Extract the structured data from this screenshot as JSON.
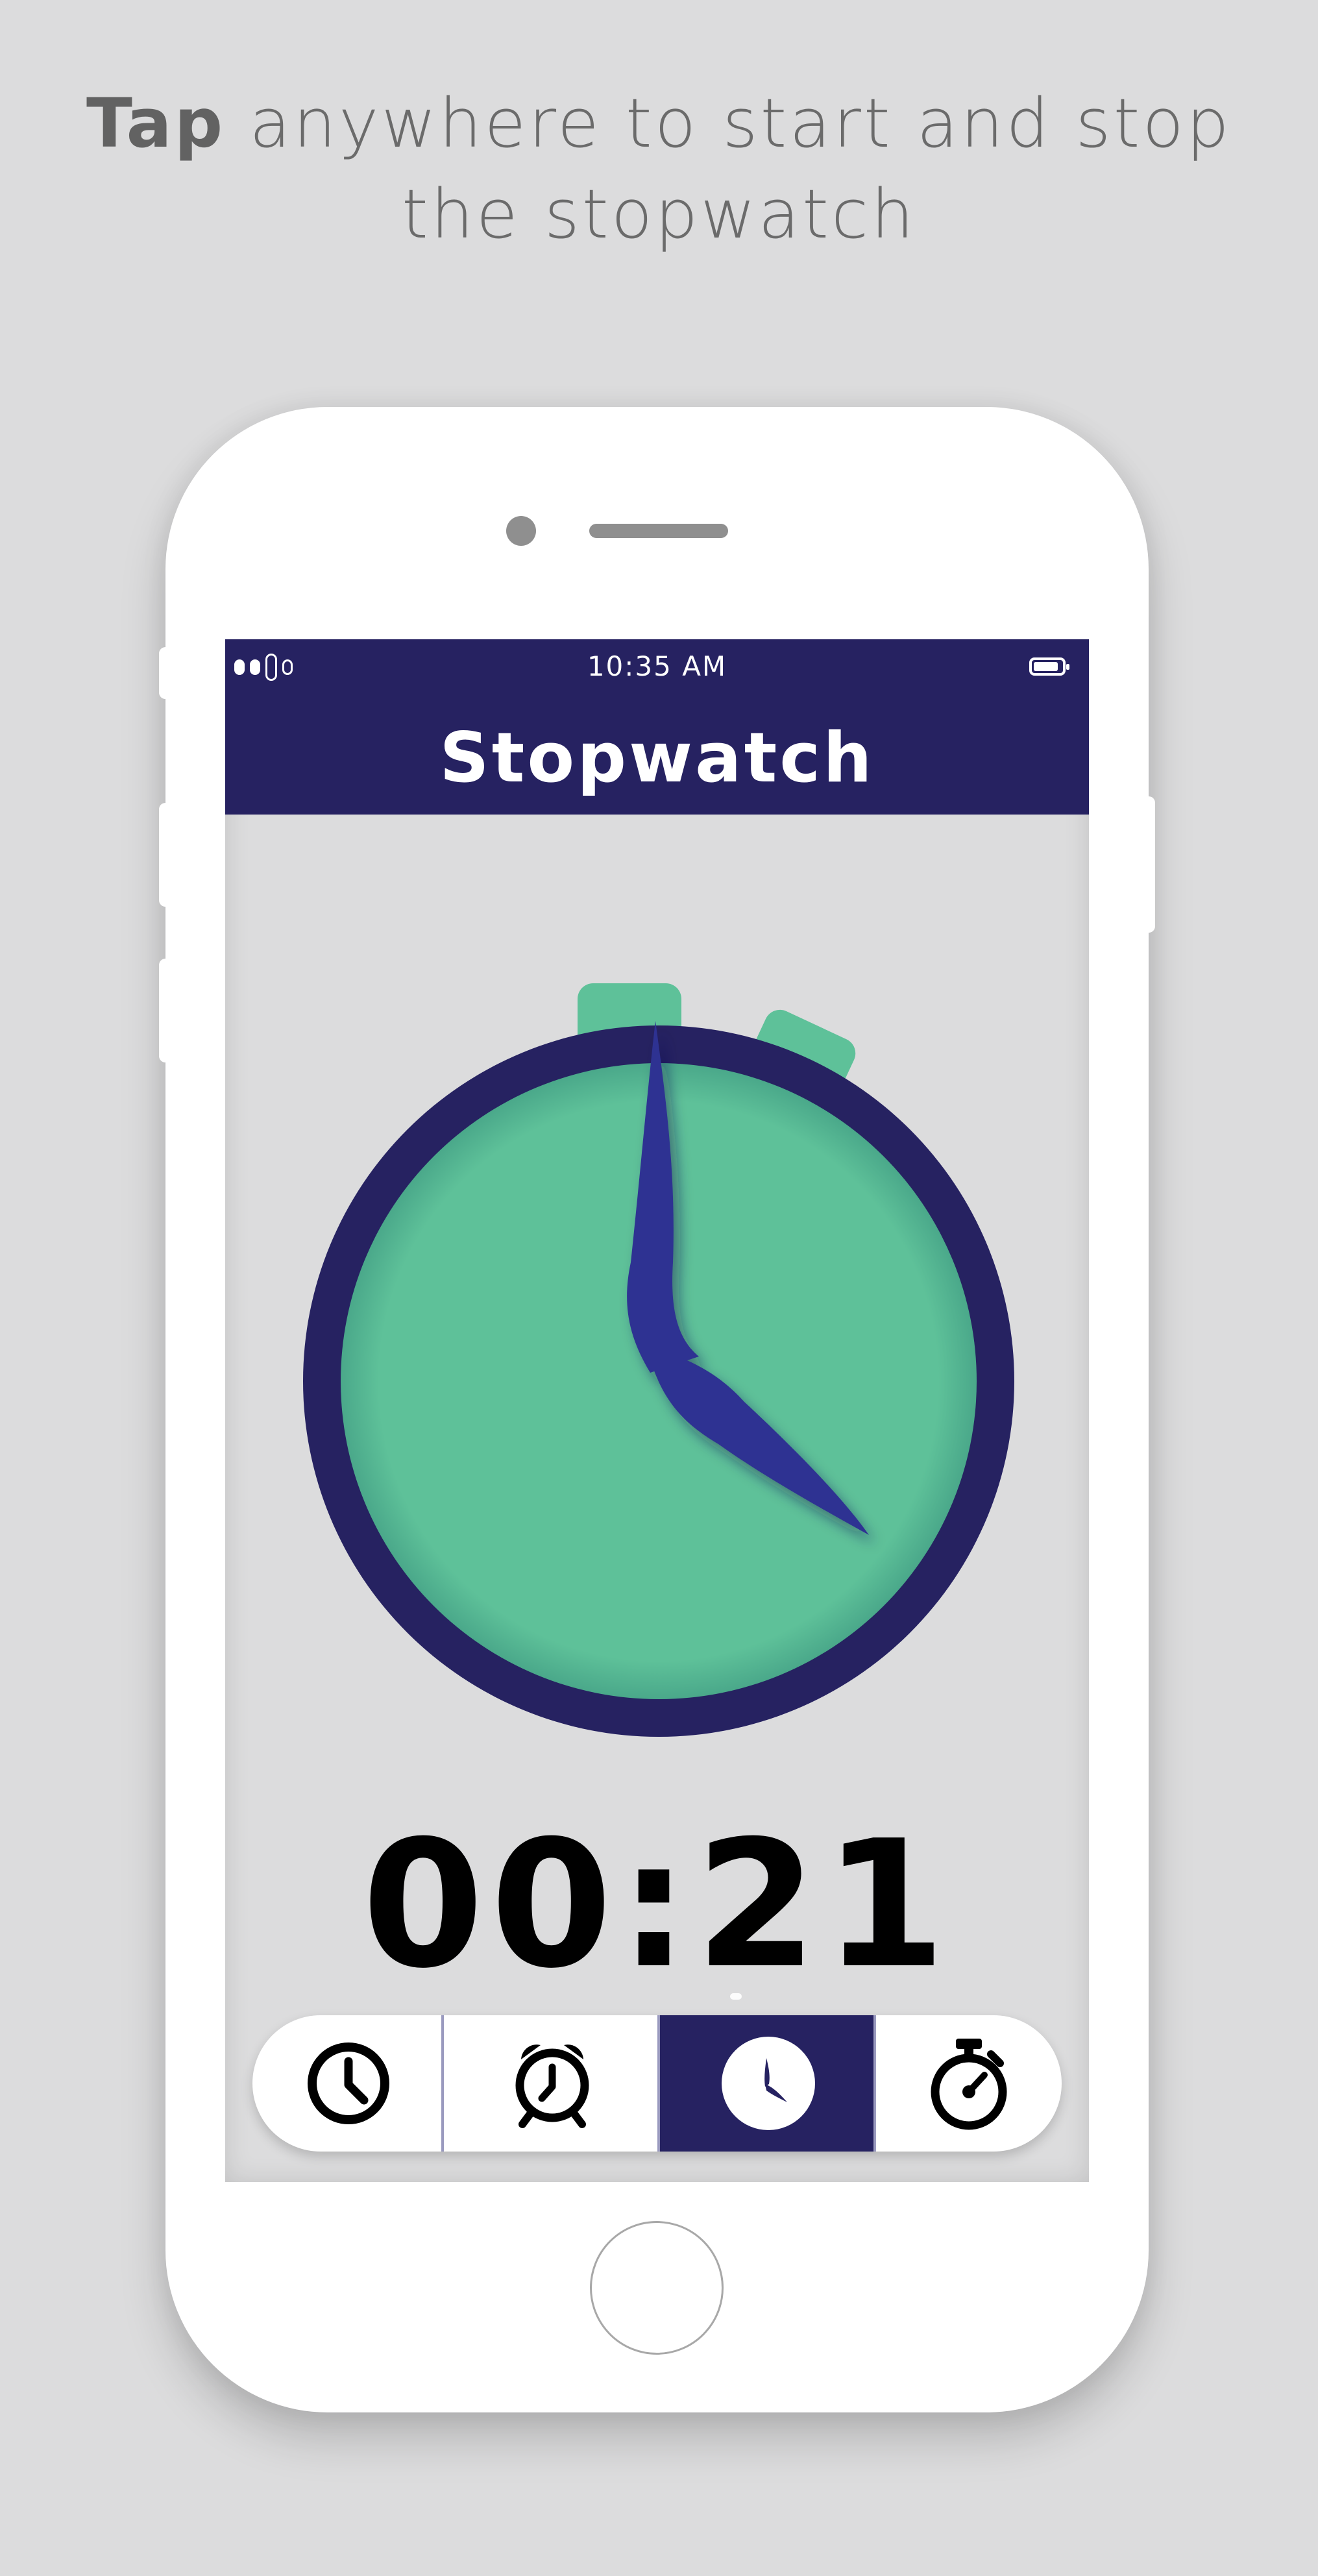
{
  "promo": {
    "headline_bold": "Tap",
    "headline_rest": " anywhere to start and stop",
    "headline_line2": "the stopwatch"
  },
  "status_bar": {
    "time": "10:35 AM"
  },
  "app": {
    "title": "Stopwatch"
  },
  "stopwatch": {
    "elapsed": "00:21"
  },
  "tabs": [
    {
      "name": "clock",
      "icon": "clock-icon",
      "active": false
    },
    {
      "name": "alarm",
      "icon": "alarm-clock-icon",
      "active": false
    },
    {
      "name": "world-clock",
      "icon": "clock-face-icon",
      "active": true
    },
    {
      "name": "stopwatch",
      "icon": "stopwatch-icon",
      "active": false
    }
  ],
  "colors": {
    "navy": "#262261",
    "mint": "#5ec199",
    "hand": "#2f3192",
    "background": "#dcdcdd"
  }
}
